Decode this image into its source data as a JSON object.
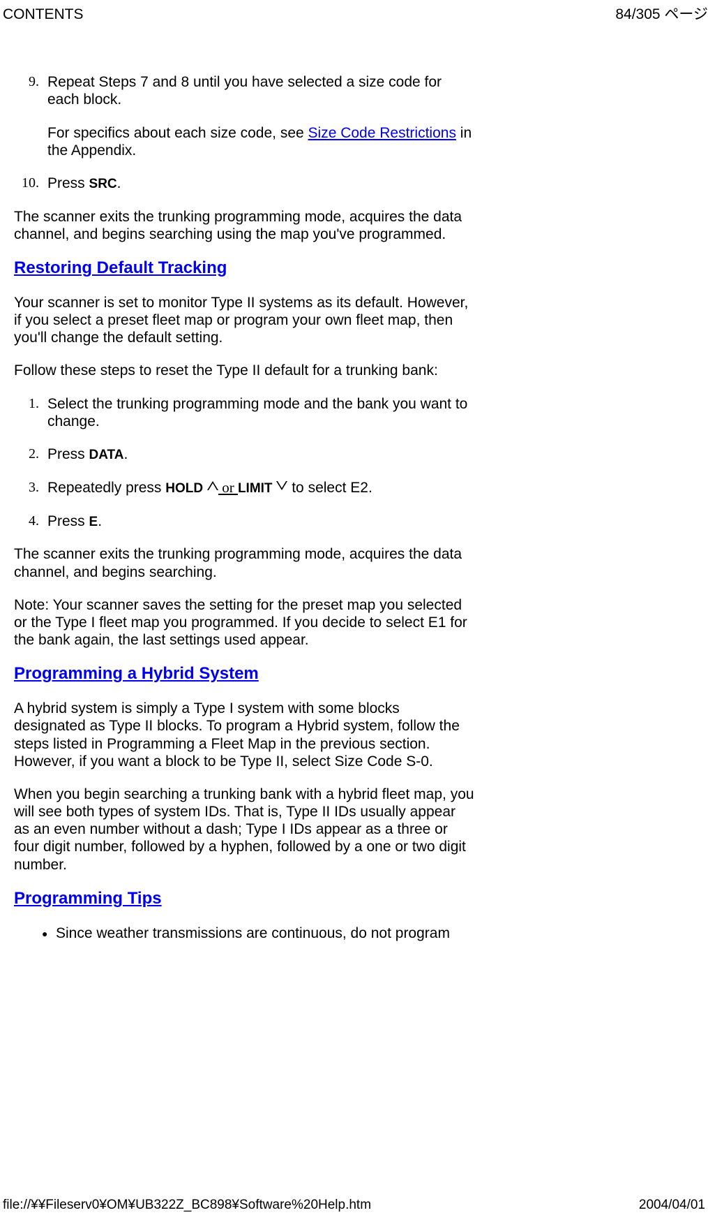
{
  "header": {
    "left": "CONTENTS",
    "right": "84/305 ページ"
  },
  "steps_a": {
    "item9": {
      "num": "9.",
      "text_pre": "Repeat Steps 7 and 8 until you have selected a size code for each block.",
      "sub_pre": "For specifics about each size code, see ",
      "sub_link": "Size Code Restrictions",
      "sub_post": " in the Appendix."
    },
    "item10": {
      "num": "10.",
      "text_pre": "Press ",
      "text_bold": "SRC",
      "text_post": "."
    }
  },
  "para1": "The scanner exits the trunking programming mode, acquires the data channel, and begins searching using the map you've programmed.",
  "h1": "Restoring Default Tracking",
  "para2": "Your scanner is set to monitor Type II systems as its default. However, if you select a preset fleet map or program your own fleet map, then you'll change the default setting.",
  "para3": "Follow these steps to reset the Type II default for a trunking bank:",
  "steps_b": {
    "item1": {
      "num": "1.",
      "text": "Select the trunking programming mode and the bank you want to change."
    },
    "item2": {
      "num": "2.",
      "text_pre": "Press ",
      "text_bold": "DATA",
      "text_post": "."
    },
    "item3": {
      "num": "3.",
      "text_pre": "Repeatedly press ",
      "bold1": "HOLD",
      "mid": " or ",
      "bold2": "LIMIT",
      "text_post": " to select E2."
    },
    "item4": {
      "num": "4.",
      "text_pre": "Press ",
      "text_bold": "E",
      "text_post": "."
    }
  },
  "para4": "The scanner exits the trunking programming mode, acquires the data channel, and begins searching.",
  "para5": "Note: Your scanner saves the setting for the preset map you selected or the Type I fleet map you programmed. If you decide to select E1 for the bank again, the last settings used appear.",
  "h2": "Programming a Hybrid System",
  "para6": "A hybrid system is simply a Type I system with some blocks designated as Type II blocks. To program a Hybrid system, follow the steps listed in Programming a Fleet Map in the previous section. However, if you want a block to be Type II, select Size Code S-0.",
  "para7": "When you begin searching a trunking bank with a hybrid fleet map, you will see both types of system IDs. That is, Type II IDs usually appear as an even number without a dash; Type I IDs appear as a three or four digit number, followed by a hyphen, followed by a one or two digit number.",
  "h3": "Programming Tips",
  "bullet1": "Since weather transmissions are continuous, do not program",
  "footer": {
    "left": "file://¥¥Fileserv0¥OM¥UB322Z_BC898¥Software%20Help.htm",
    "right": "2004/04/01"
  }
}
